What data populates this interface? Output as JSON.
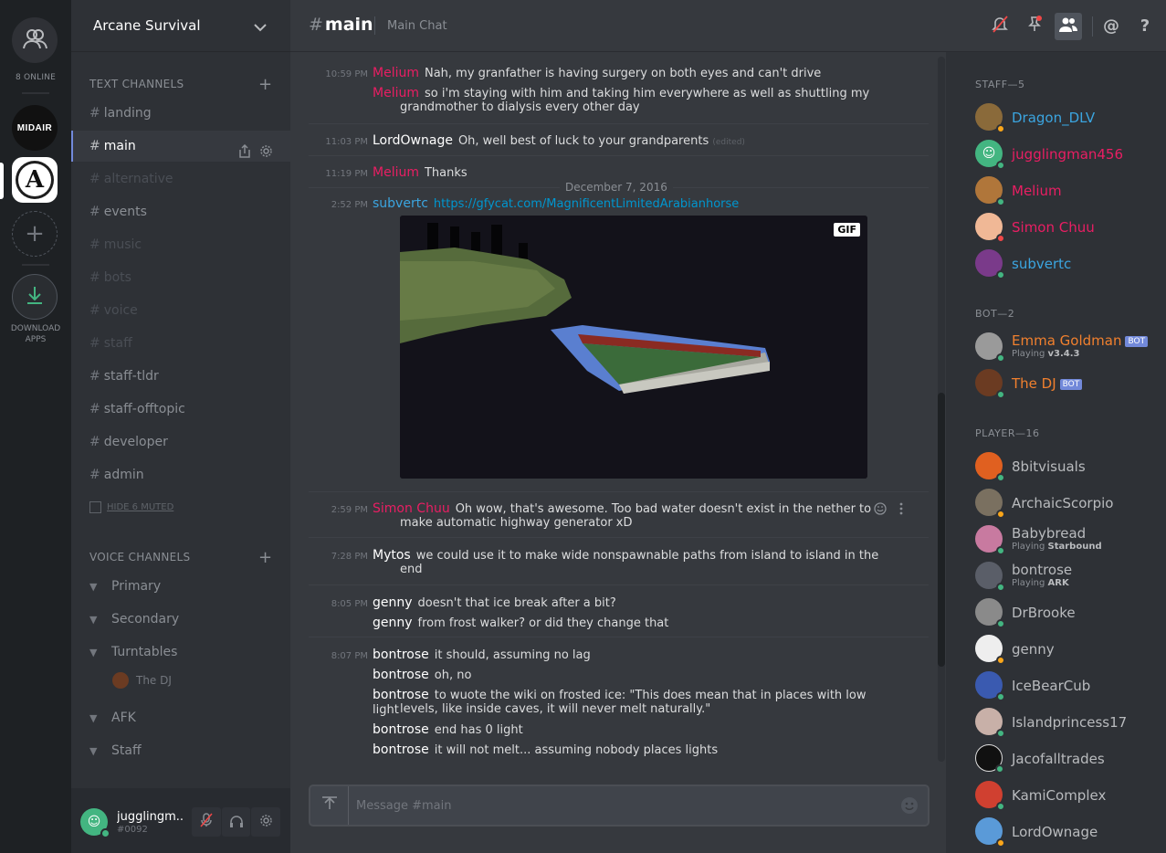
{
  "colors": {
    "accent": "#7289da",
    "staff_blue": "#3ba5e0",
    "staff_pink": "#e91e63",
    "bot_orange": "#f1802e",
    "online": "#43b581",
    "idle": "#faa61a",
    "dnd": "#f04747"
  },
  "rail": {
    "online_label": "8 ONLINE",
    "servers": [
      {
        "label": "MIDAIR"
      },
      {
        "label": "A"
      }
    ],
    "download_label": "DOWNLOAD\nAPPS"
  },
  "server": {
    "name": "Arcane Survival"
  },
  "text_category": "TEXT CHANNELS",
  "text_channels": [
    {
      "name": "landing",
      "muted": false
    },
    {
      "name": "main",
      "muted": false,
      "active": true
    },
    {
      "name": "alternative",
      "muted": true
    },
    {
      "name": "events",
      "muted": false
    },
    {
      "name": "music",
      "muted": true
    },
    {
      "name": "bots",
      "muted": true
    },
    {
      "name": "voice",
      "muted": true
    },
    {
      "name": "staff",
      "muted": true
    },
    {
      "name": "staff-tldr",
      "muted": false
    },
    {
      "name": "staff-offtopic",
      "muted": false
    },
    {
      "name": "developer",
      "muted": false
    },
    {
      "name": "admin",
      "muted": false
    }
  ],
  "hide_muted": "HIDE 6 MUTED",
  "voice_category": "VOICE CHANNELS",
  "voice_channels": [
    "Primary",
    "Secondary",
    "Turntables",
    "AFK",
    "Staff"
  ],
  "voice_user": "The DJ",
  "user": {
    "name": "jugglingm...",
    "tag": "#0092"
  },
  "chat": {
    "channel": "main",
    "topic": "Main Chat",
    "date_divider": "December 7, 2016",
    "placeholder": "Message #main",
    "gif_label": "GIF",
    "messages": [
      {
        "time": "10:59 PM",
        "author": "Melium",
        "text": "Nah, my granfather is having surgery on both eyes and can't drive"
      },
      {
        "author": "Melium",
        "text": "so i'm staying with him and taking him everywhere as well as shuttling my",
        "cont": "grandmother to dialysis every other day"
      },
      {
        "time": "11:03 PM",
        "author": "LordOwnage",
        "text": "Oh, well best of luck to your grandparents",
        "edited": "(edited)"
      },
      {
        "time": "11:19 PM",
        "author": "Melium",
        "text": "Thanks"
      },
      {
        "time": "2:52 PM",
        "author": "subvertc",
        "link": "https://gfycat.com/MagnificentLimitedArabianhorse"
      },
      {
        "time": "2:59 PM",
        "author": "Simon Chuu",
        "text": "Oh wow, that's awesome. Too bad water doesn't exist in the nether to",
        "cont": "make automatic highway generator xD"
      },
      {
        "time": "7:28 PM",
        "author": "Mytos",
        "text": "we could use it to make wide nonspawnable paths from island to island in the",
        "cont": "end"
      },
      {
        "time": "8:05 PM",
        "author": "genny",
        "text": "doesn't that ice break after a bit?"
      },
      {
        "author": "genny",
        "text": "from frost walker? or did they change that"
      },
      {
        "time": "8:07 PM",
        "author": "bontrose",
        "text": "it should, assuming no lag"
      },
      {
        "author": "bontrose",
        "text": "oh, no"
      },
      {
        "author": "bontrose",
        "text": "to wuote the wiki on frosted ice: \"This does mean that in places with low light",
        "cont": "levels, like inside caves, it will never melt naturally.\""
      },
      {
        "author": "bontrose",
        "text": "end has 0 light"
      },
      {
        "author": "bontrose",
        "text": "it will not melt... assuming nobody places lights"
      }
    ]
  },
  "members": {
    "staff_label": "STAFF—5",
    "bot_label": "BOT—2",
    "player_label": "PLAYER—16",
    "staff": [
      {
        "name": "Dragon_DLV",
        "color": "#3ba5e0",
        "status": "idle"
      },
      {
        "name": "jugglingman456",
        "color": "#e91e63",
        "status": "online"
      },
      {
        "name": "Melium",
        "color": "#e91e63",
        "status": "online"
      },
      {
        "name": "Simon Chuu",
        "color": "#e91e63",
        "status": "dnd"
      },
      {
        "name": "subvertc",
        "color": "#3ba5e0",
        "status": "online"
      }
    ],
    "bots": [
      {
        "name": "Emma Goldman",
        "tag": "BOT",
        "game": "v3.4.3",
        "playing": "Playing"
      },
      {
        "name": "The DJ",
        "tag": "BOT"
      }
    ],
    "players": [
      {
        "name": "8bitvisuals",
        "status": "online"
      },
      {
        "name": "ArchaicScorpio",
        "status": "idle"
      },
      {
        "name": "Babybread",
        "playing": "Playing",
        "game": "Starbound",
        "status": "online"
      },
      {
        "name": "bontrose",
        "playing": "Playing",
        "game": "ARK",
        "status": "online"
      },
      {
        "name": "DrBrooke",
        "status": "online"
      },
      {
        "name": "genny",
        "status": "idle"
      },
      {
        "name": "IceBearCub",
        "status": "online"
      },
      {
        "name": "Islandprincess17",
        "status": "online"
      },
      {
        "name": "Jacofalltrades",
        "status": "online"
      },
      {
        "name": "KamiComplex",
        "status": "online"
      },
      {
        "name": "LordOwnage",
        "status": "idle"
      }
    ]
  }
}
